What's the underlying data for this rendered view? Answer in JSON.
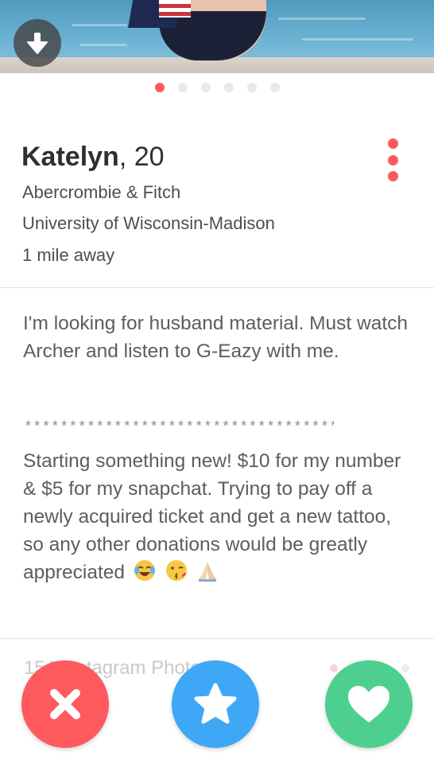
{
  "photo": {
    "download_icon": "download-arrow-icon",
    "page_count": 6,
    "active_index": 0
  },
  "profile": {
    "name": "Katelyn",
    "separator": ", ",
    "age": "20",
    "job": "Abercrombie & Fitch",
    "school": "University of Wisconsin-Madison",
    "distance": "1 mile away",
    "more_icon": "more-vertical-icon"
  },
  "bio": {
    "paragraph1": "I'm looking for husband material. Must watch Archer and listen to G-Eazy with me.",
    "separator": "***************************************",
    "paragraph2": "Starting something new! $10 for my number & $5 for my snapchat. Trying to pay off a newly acquired ticket and get a new tattoo, so any other donations would be greatly appreciated",
    "emojis": [
      "tears-of-joy-emoji-icon",
      "kissing-face-emoji-icon",
      "praying-hands-emoji-icon"
    ]
  },
  "instagram": {
    "label": "154 Instagram Photos"
  },
  "actions": {
    "nope_icon": "close-icon",
    "super_like_icon": "star-icon",
    "like_icon": "heart-icon"
  },
  "colors": {
    "brand_red": "#fe5a5e",
    "super_like_blue": "#3ea8f6",
    "like_green": "#4ccf8f"
  }
}
